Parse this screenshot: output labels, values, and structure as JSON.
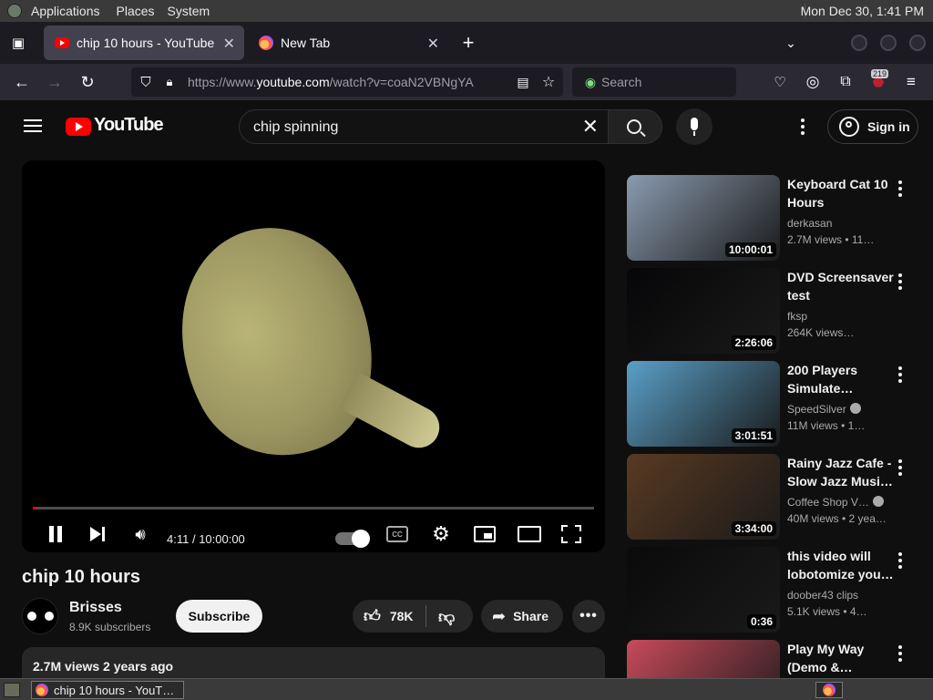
{
  "panel": {
    "menus": [
      "Applications",
      "Places",
      "System"
    ],
    "clock": "Mon Dec 30,  1:41 PM"
  },
  "browser": {
    "tabs": [
      {
        "label": "chip 10 hours - YouTube",
        "icon": "youtube-favicon",
        "active": true
      },
      {
        "label": "New Tab",
        "icon": "firefox-favicon",
        "active": false
      }
    ],
    "url_prefix": "https://www.",
    "url_domain": "youtube.com",
    "url_path": "/watch?v=coaN2VBNgYA",
    "search_placeholder": "Search",
    "extension_badge": "219"
  },
  "youtube": {
    "logo_text": "YouTube",
    "search_query": "chip spinning",
    "sign_in": "Sign in",
    "player": {
      "current_time": "4:11",
      "duration": "10:00:00",
      "progress": 0.007
    },
    "video": {
      "title": "chip 10 hours",
      "channel": "Brisses",
      "subscribers": "8.9K subscribers",
      "subscribe_label": "Subscribe",
      "likes": "78K",
      "share_label": "Share",
      "views_line": "2.7M views  2 years ago"
    },
    "recommendations": [
      {
        "title": "Keyboard Cat 10 Hours",
        "channel": "derkasan",
        "meta": "2.7M views  • 11…",
        "duration": "10:00:01",
        "verified": false,
        "thumb_color": "#8a9bb0"
      },
      {
        "title": "DVD Screensaver test",
        "channel": "fksp",
        "meta": "264K views…",
        "duration": "2:26:06",
        "verified": false,
        "thumb_color": "#060608"
      },
      {
        "title": "200 Players Simulate…",
        "channel": "SpeedSilver",
        "meta": "11M views  • 1…",
        "duration": "3:01:51",
        "verified": true,
        "thumb_color": "#5aa0c8"
      },
      {
        "title": "Rainy Jazz Cafe - Slow Jazz Musi…",
        "channel": "Coffee Shop V…",
        "meta": "40M views  • 2 yea…",
        "duration": "3:34:00",
        "verified": true,
        "thumb_color": "#5a3a22"
      },
      {
        "title": "this video will lobotomize you…",
        "channel": "doober43 clips",
        "meta": "5.1K views  • 4…",
        "duration": "0:36",
        "verified": false,
        "thumb_color": "#0a0a0a"
      },
      {
        "title": "Play My Way (Demo &…",
        "channel": "",
        "meta": "",
        "duration": "",
        "verified": false,
        "thumb_color": "#c84a5a"
      }
    ]
  },
  "taskbar": {
    "window_label": "chip 10 hours - YouT…"
  }
}
